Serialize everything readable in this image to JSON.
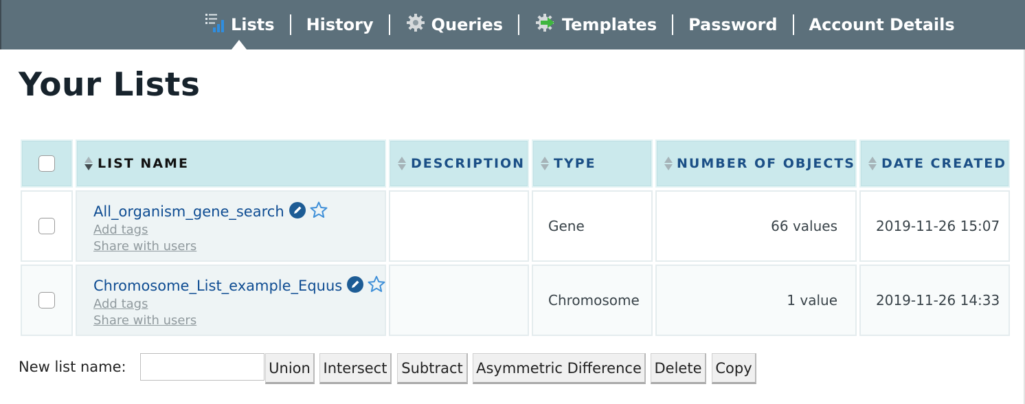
{
  "nav": {
    "items": [
      {
        "label": "Lists",
        "icon": "list-chart-icon"
      },
      {
        "label": "History",
        "icon": ""
      },
      {
        "label": "Queries",
        "icon": "gear-icon"
      },
      {
        "label": "Templates",
        "icon": "gear-arrow-icon"
      },
      {
        "label": "Password",
        "icon": ""
      },
      {
        "label": "Account Details",
        "icon": ""
      }
    ],
    "active": "Lists"
  },
  "page": {
    "title": "Your Lists"
  },
  "table": {
    "columns": [
      {
        "label": "LIST NAME"
      },
      {
        "label": "DESCRIPTION"
      },
      {
        "label": "TYPE"
      },
      {
        "label": "NUMBER OF OBJECTS"
      },
      {
        "label": "DATE CREATED"
      }
    ],
    "rows": [
      {
        "name": "All_organism_gene_search",
        "add_tags": "Add tags",
        "share": "Share with users",
        "description": "",
        "type": "Gene",
        "count": "66 values",
        "created": "2019-11-26 15:07"
      },
      {
        "name": "Chromosome_List_example_Equus",
        "add_tags": "Add tags",
        "share": "Share with users",
        "description": "",
        "type": "Chromosome",
        "count": "1 value",
        "created": "2019-11-26 14:33"
      }
    ]
  },
  "operations": {
    "label": "New list name:",
    "input_value": "",
    "buttons": {
      "union": "Union",
      "intersect": "Intersect",
      "subtract": "Subtract",
      "asymmetric_difference": "Asymmetric Difference",
      "delete": "Delete",
      "copy": "Copy"
    }
  },
  "colors": {
    "nav_bg": "#5c707b",
    "header_bg": "#cbe9ec",
    "link": "#0e4c92",
    "title": "#17232c"
  }
}
